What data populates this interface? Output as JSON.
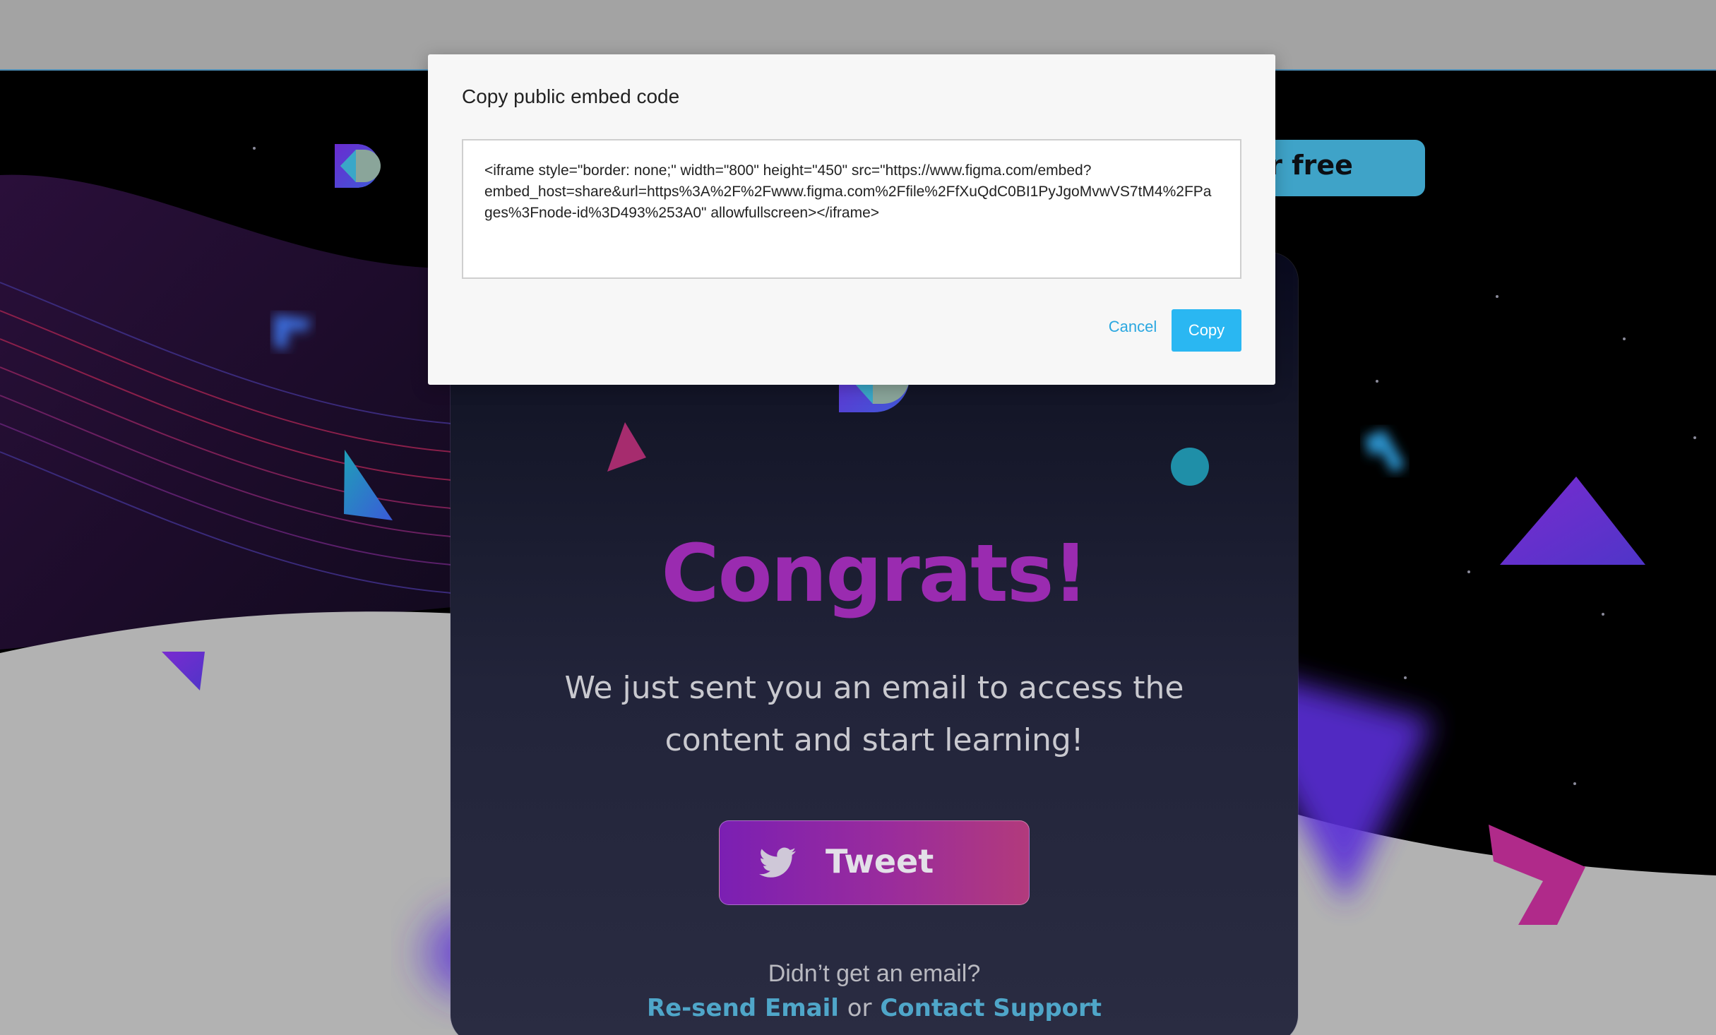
{
  "modal": {
    "title": "Copy public embed code",
    "embed_code": "<iframe style=\"border: none;\" width=\"800\" height=\"450\" src=\"https://www.figma.com/embed?embed_host=share&url=https%3A%2F%2Fwww.figma.com%2Ffile%2FfXuQdC0BI1PyJgoMvwVS7tM4%2FPages%3Fnode-id%3D493%253A0\" allowfullscreen></iframe>",
    "cancel_label": "Cancel",
    "copy_label": "Copy"
  },
  "header": {
    "cta_label": "Try for free"
  },
  "card": {
    "title": "Congrats!",
    "message": "We just sent you an email to access the content and start learning!",
    "tweet_label": "Tweet",
    "didnt_get": "Didn’t get an email?",
    "resend_label": "Re-send Email",
    "or_label": "or",
    "support_label": "Contact Support"
  },
  "colors": {
    "accent_blue": "#2ab7f2",
    "cta_blue": "#3fa3c8",
    "title_gradient": [
      "#8a1fb8",
      "#b0357d"
    ],
    "link_blue": "#4fa6c9"
  },
  "icons": [
    "brand-logo-icon",
    "twitter-bird-icon"
  ]
}
